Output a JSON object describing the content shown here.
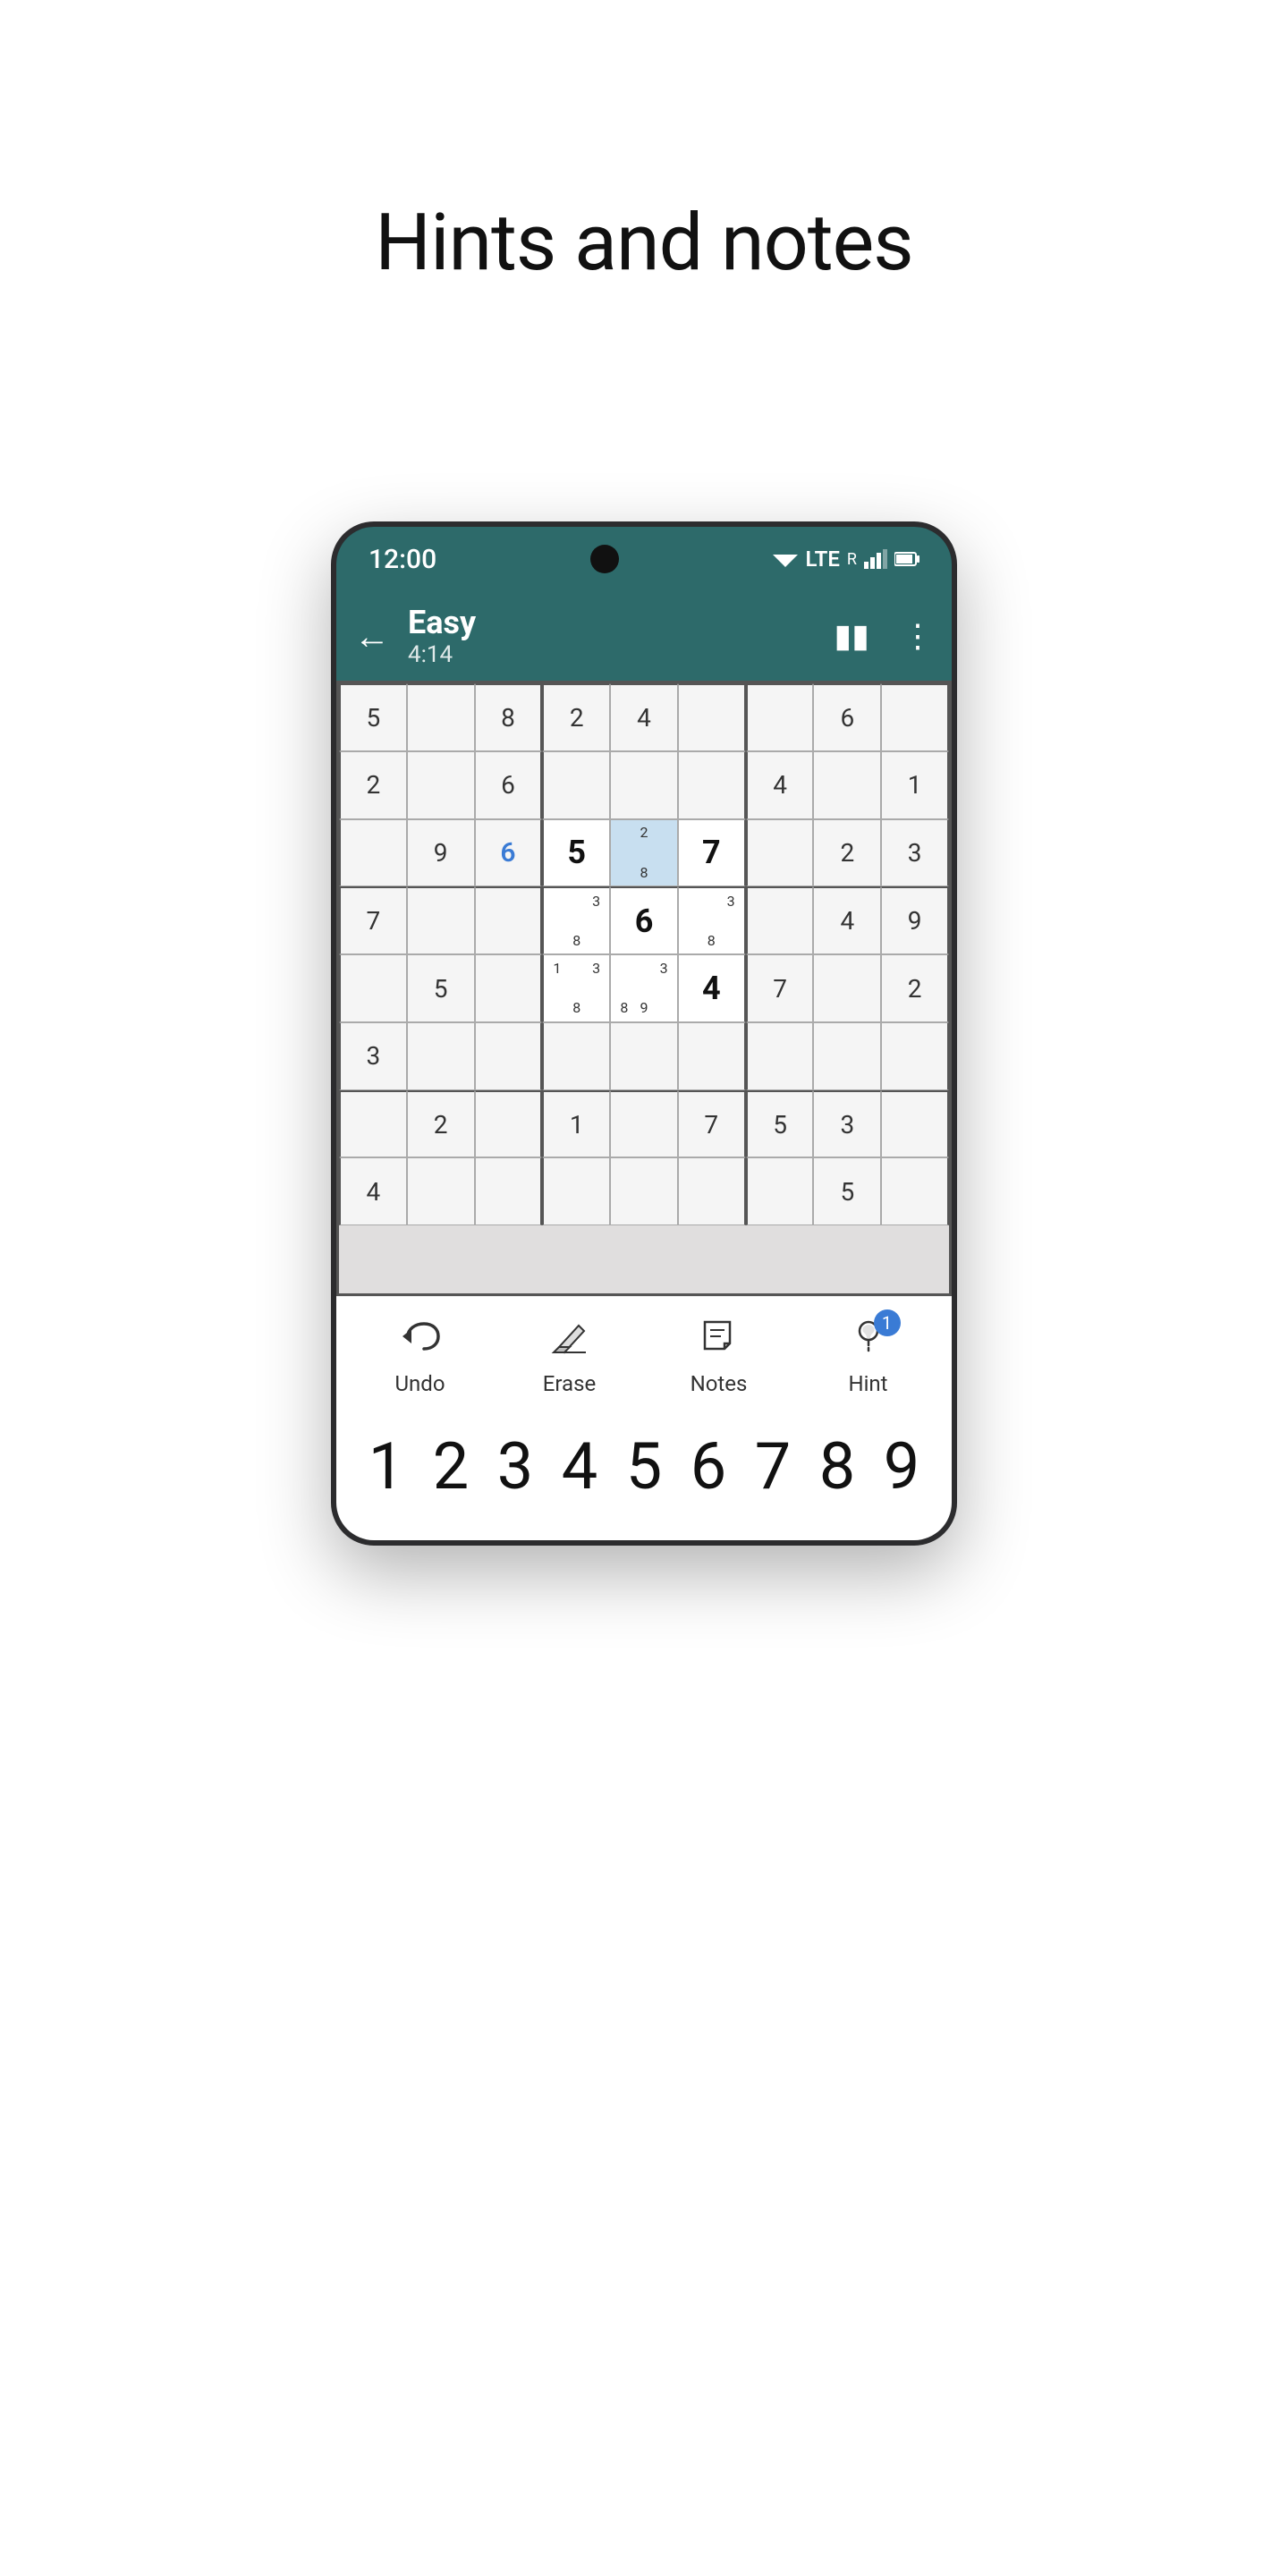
{
  "page": {
    "title": "Hints and notes"
  },
  "status_bar": {
    "time": "12:00",
    "lte": "LTE",
    "r_label": "R"
  },
  "app_bar": {
    "game_mode": "Easy",
    "timer": "4:14"
  },
  "controls": {
    "undo_label": "Undo",
    "erase_label": "Erase",
    "notes_label": "Notes",
    "hint_label": "Hint",
    "hint_count": "1"
  },
  "number_pad": {
    "keys": [
      "1",
      "2",
      "3",
      "4",
      "5",
      "6",
      "7",
      "8",
      "9"
    ]
  },
  "grid": {
    "cells": [
      {
        "row": 0,
        "col": 0,
        "value": "5",
        "type": "given"
      },
      {
        "row": 0,
        "col": 1,
        "value": "",
        "type": "empty"
      },
      {
        "row": 0,
        "col": 2,
        "value": "8",
        "type": "given"
      },
      {
        "row": 0,
        "col": 3,
        "value": "2",
        "type": "given"
      },
      {
        "row": 0,
        "col": 4,
        "value": "4",
        "type": "given"
      },
      {
        "row": 0,
        "col": 5,
        "value": "",
        "type": "empty"
      },
      {
        "row": 0,
        "col": 6,
        "value": "",
        "type": "empty"
      },
      {
        "row": 0,
        "col": 7,
        "value": "6",
        "type": "given"
      },
      {
        "row": 0,
        "col": 8,
        "value": "",
        "type": "empty"
      },
      {
        "row": 1,
        "col": 0,
        "value": "2",
        "type": "given"
      },
      {
        "row": 1,
        "col": 1,
        "value": "",
        "type": "empty"
      },
      {
        "row": 1,
        "col": 2,
        "value": "6",
        "type": "given"
      },
      {
        "row": 1,
        "col": 3,
        "value": "",
        "type": "empty"
      },
      {
        "row": 1,
        "col": 4,
        "value": "",
        "type": "empty"
      },
      {
        "row": 1,
        "col": 5,
        "value": "",
        "type": "empty"
      },
      {
        "row": 1,
        "col": 6,
        "value": "4",
        "type": "given"
      },
      {
        "row": 1,
        "col": 7,
        "value": "",
        "type": "empty"
      },
      {
        "row": 1,
        "col": 8,
        "value": "1",
        "type": "given"
      },
      {
        "row": 2,
        "col": 0,
        "value": "",
        "type": "empty"
      },
      {
        "row": 2,
        "col": 1,
        "value": "9",
        "type": "given"
      },
      {
        "row": 2,
        "col": 2,
        "value": "6",
        "type": "user-blue"
      },
      {
        "row": 2,
        "col": 3,
        "value": "5",
        "type": "focus",
        "big": "5"
      },
      {
        "row": 2,
        "col": 4,
        "value": "",
        "type": "focus-highlight",
        "notes": [
          "",
          "2",
          "",
          "",
          "",
          "",
          "",
          "8",
          ""
        ]
      },
      {
        "row": 2,
        "col": 5,
        "value": "7",
        "type": "focus",
        "big": "7"
      },
      {
        "row": 2,
        "col": 6,
        "value": "",
        "type": "empty"
      },
      {
        "row": 2,
        "col": 7,
        "value": "2",
        "type": "given"
      },
      {
        "row": 2,
        "col": 8,
        "value": "3",
        "type": "given"
      },
      {
        "row": 3,
        "col": 0,
        "value": "7",
        "type": "given"
      },
      {
        "row": 3,
        "col": 1,
        "value": "",
        "type": "empty"
      },
      {
        "row": 3,
        "col": 2,
        "value": "",
        "type": "empty"
      },
      {
        "row": 3,
        "col": 3,
        "value": "",
        "type": "focus",
        "notes": [
          "",
          "",
          "3",
          "",
          "",
          "",
          "",
          "8",
          ""
        ]
      },
      {
        "row": 3,
        "col": 4,
        "value": "6",
        "type": "focus",
        "big": "6"
      },
      {
        "row": 3,
        "col": 5,
        "value": "",
        "type": "focus",
        "notes": [
          "",
          "",
          "3",
          "",
          "",
          "",
          "",
          "8",
          ""
        ]
      },
      {
        "row": 3,
        "col": 6,
        "value": "",
        "type": "empty"
      },
      {
        "row": 3,
        "col": 7,
        "value": "4",
        "type": "given"
      },
      {
        "row": 3,
        "col": 8,
        "value": "9",
        "type": "given"
      },
      {
        "row": 4,
        "col": 0,
        "value": "",
        "type": "empty"
      },
      {
        "row": 4,
        "col": 1,
        "value": "5",
        "type": "given"
      },
      {
        "row": 4,
        "col": 2,
        "value": "",
        "type": "empty"
      },
      {
        "row": 4,
        "col": 3,
        "value": "",
        "type": "focus",
        "notes": [
          "1",
          "",
          "3",
          "",
          "",
          "",
          "",
          "8",
          ""
        ]
      },
      {
        "row": 4,
        "col": 4,
        "value": "",
        "type": "focus",
        "notes": [
          "",
          "",
          "3",
          "",
          "",
          "",
          "8",
          "9",
          ""
        ]
      },
      {
        "row": 4,
        "col": 5,
        "value": "4",
        "type": "focus",
        "big": "4"
      },
      {
        "row": 4,
        "col": 6,
        "value": "7",
        "type": "given"
      },
      {
        "row": 4,
        "col": 7,
        "value": "",
        "type": "empty"
      },
      {
        "row": 4,
        "col": 8,
        "value": "2",
        "type": "given"
      },
      {
        "row": 5,
        "col": 0,
        "value": "3",
        "type": "given"
      },
      {
        "row": 5,
        "col": 1,
        "value": "",
        "type": "empty"
      },
      {
        "row": 5,
        "col": 2,
        "value": "",
        "type": "empty"
      },
      {
        "row": 5,
        "col": 3,
        "value": "",
        "type": "empty"
      },
      {
        "row": 5,
        "col": 4,
        "value": "",
        "type": "empty"
      },
      {
        "row": 5,
        "col": 5,
        "value": "",
        "type": "empty"
      },
      {
        "row": 5,
        "col": 6,
        "value": "",
        "type": "empty"
      },
      {
        "row": 5,
        "col": 7,
        "value": "",
        "type": "empty"
      },
      {
        "row": 5,
        "col": 8,
        "value": "",
        "type": "empty"
      },
      {
        "row": 6,
        "col": 0,
        "value": "",
        "type": "empty"
      },
      {
        "row": 6,
        "col": 1,
        "value": "2",
        "type": "given"
      },
      {
        "row": 6,
        "col": 2,
        "value": "",
        "type": "empty"
      },
      {
        "row": 6,
        "col": 3,
        "value": "1",
        "type": "given"
      },
      {
        "row": 6,
        "col": 4,
        "value": "",
        "type": "empty"
      },
      {
        "row": 6,
        "col": 5,
        "value": "7",
        "type": "given"
      },
      {
        "row": 6,
        "col": 6,
        "value": "5",
        "type": "given"
      },
      {
        "row": 6,
        "col": 7,
        "value": "3",
        "type": "given"
      },
      {
        "row": 6,
        "col": 8,
        "value": "",
        "type": "empty"
      },
      {
        "row": 7,
        "col": 0,
        "value": "4",
        "type": "given"
      },
      {
        "row": 7,
        "col": 1,
        "value": "",
        "type": "empty"
      },
      {
        "row": 7,
        "col": 2,
        "value": "",
        "type": "empty"
      },
      {
        "row": 7,
        "col": 3,
        "value": "",
        "type": "empty"
      },
      {
        "row": 7,
        "col": 4,
        "value": "",
        "type": "empty"
      },
      {
        "row": 7,
        "col": 5,
        "value": "",
        "type": "empty"
      },
      {
        "row": 7,
        "col": 6,
        "value": "",
        "type": "empty"
      },
      {
        "row": 7,
        "col": 7,
        "value": "5",
        "type": "given"
      },
      {
        "row": 7,
        "col": 8,
        "value": "",
        "type": "empty"
      }
    ]
  }
}
